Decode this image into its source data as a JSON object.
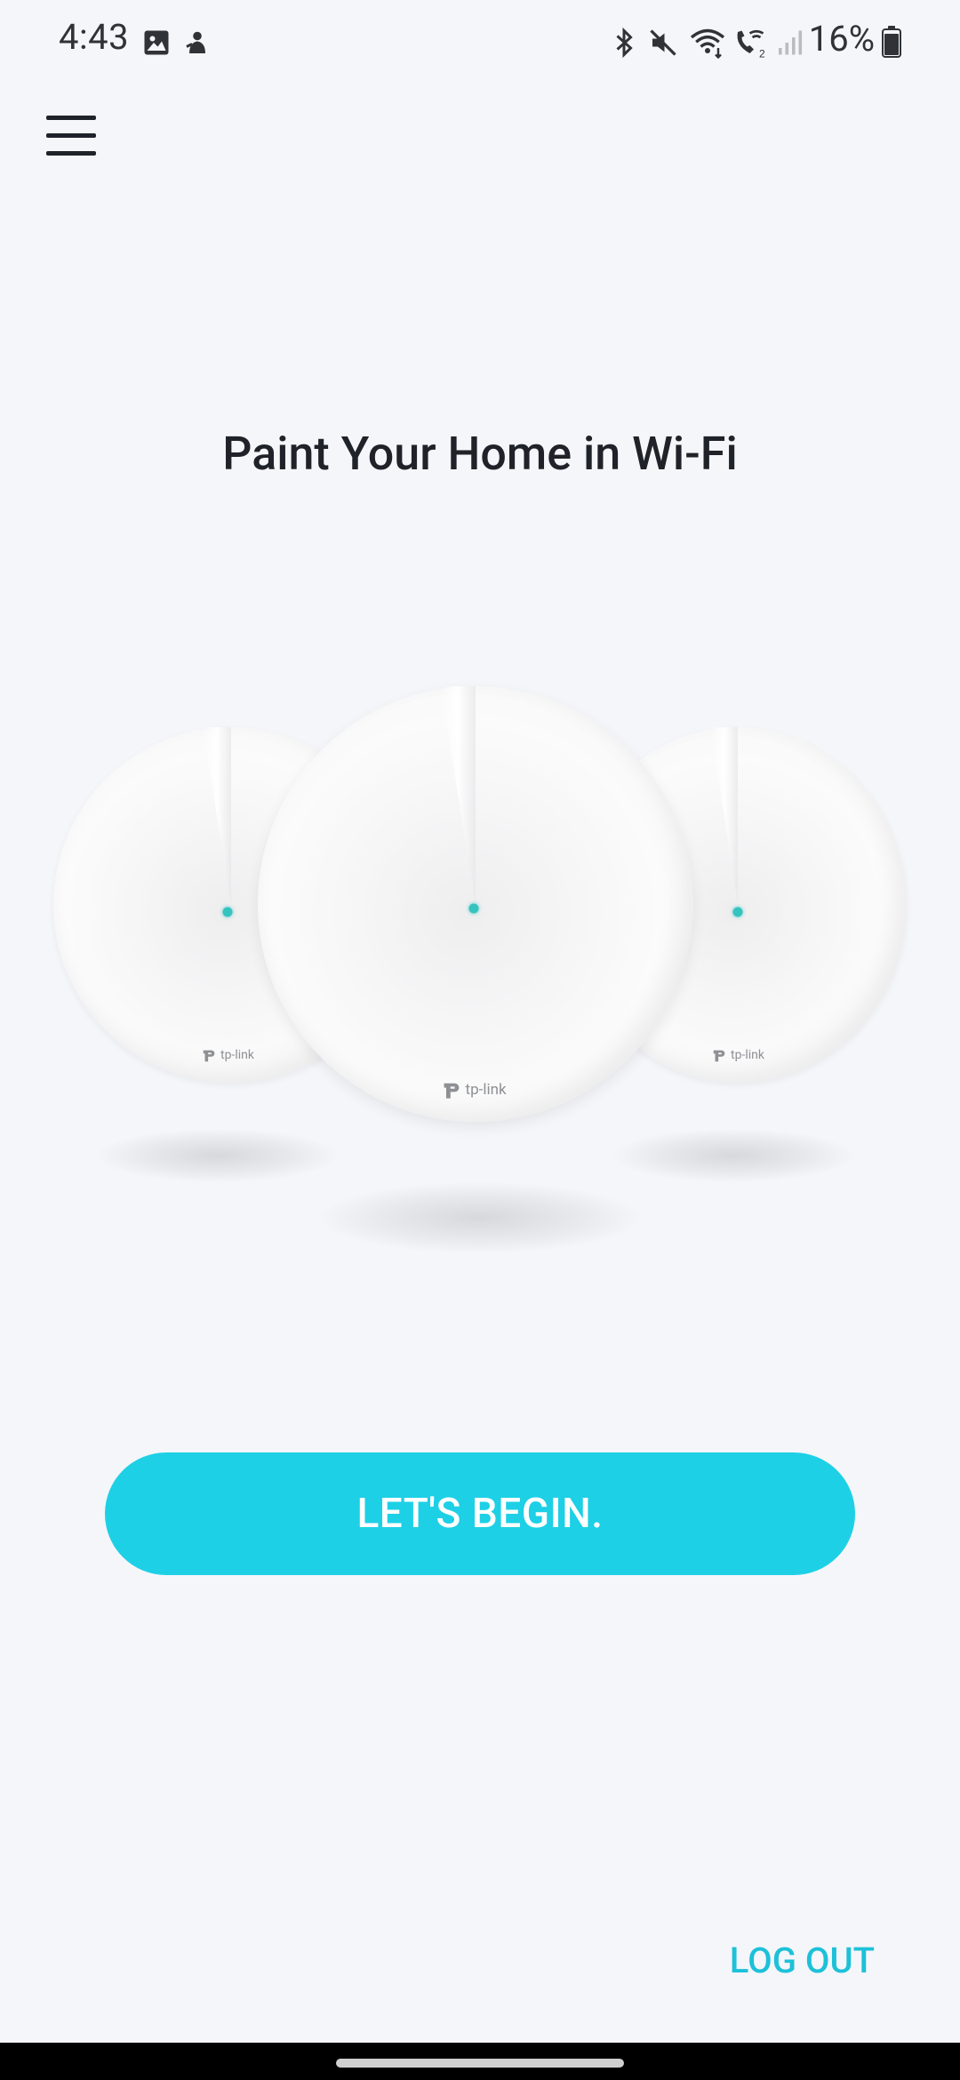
{
  "status_bar": {
    "time": "4:43",
    "battery_percent": "16%",
    "icons": [
      "gallery-icon",
      "app-notification-icon",
      "bluetooth-icon",
      "mute-icon",
      "wifi-icon",
      "wifi-calling-icon",
      "signal-icon",
      "battery-icon"
    ]
  },
  "header": {
    "menu_icon": "hamburger-menu-icon"
  },
  "main": {
    "title": "Paint Your Home in Wi-Fi",
    "hero": {
      "devices": [
        {
          "logo": "tp-link"
        },
        {
          "logo": "tp-link"
        },
        {
          "logo": "tp-link"
        }
      ],
      "accent_color": "#36c3c0"
    },
    "primary_button_label": "LET'S BEGIN.",
    "primary_color": "#1dd0e6"
  },
  "footer": {
    "logout_label": "LOG OUT",
    "link_color": "#1dc1d8"
  }
}
